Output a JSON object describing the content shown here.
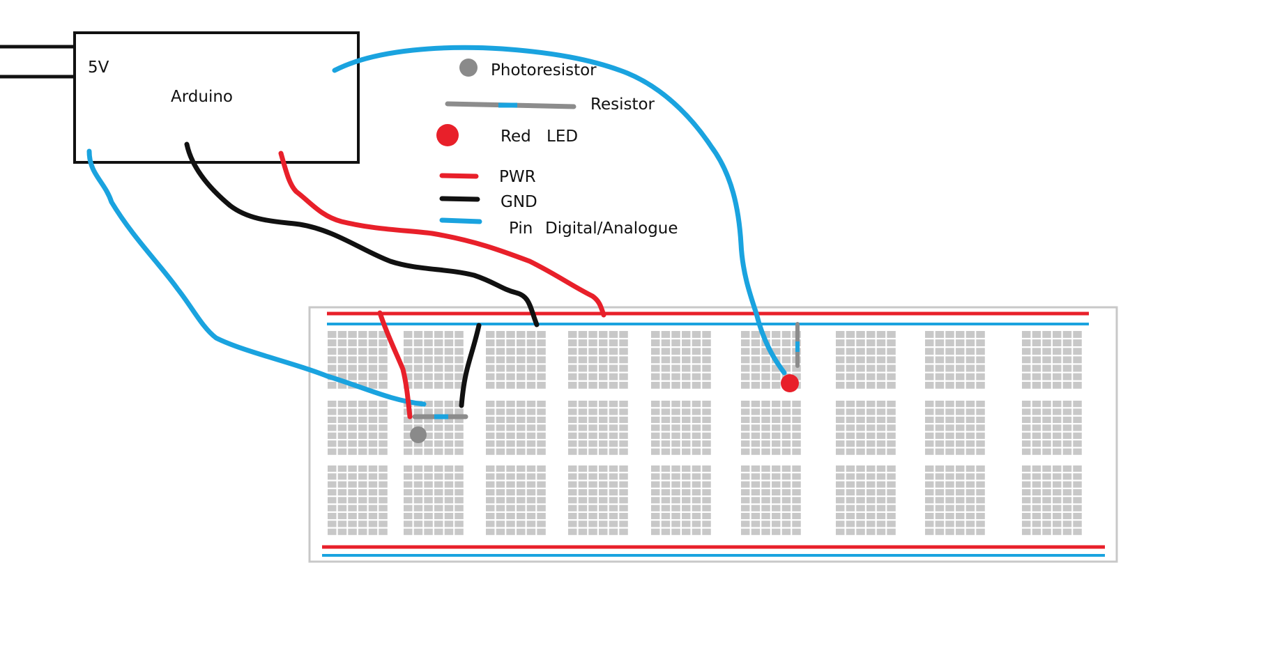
{
  "arduino": {
    "power_label": "5V",
    "name": "Arduino"
  },
  "legend": {
    "photoresistor": "Photoresistor",
    "resistor": "Resistor",
    "led_color": "Red",
    "led": "LED",
    "pwr": "PWR",
    "gnd": "GND",
    "pin": "Pin",
    "pin_type": "Digital/Analogue"
  },
  "colors": {
    "pwr": "#e8202a",
    "gnd": "#111111",
    "pin": "#1aa3df",
    "resistor": "#8c8c8c",
    "photoresistor": "#8a8a8a",
    "led": "#e8202a",
    "breadboard_hole": "#c8c8c8",
    "breadboard_border": "#c8c8c8"
  },
  "breadboard": {
    "column_groups": 9,
    "row_blocks": 3,
    "rails": [
      "pwr",
      "pin",
      "pwr",
      "pin"
    ]
  }
}
